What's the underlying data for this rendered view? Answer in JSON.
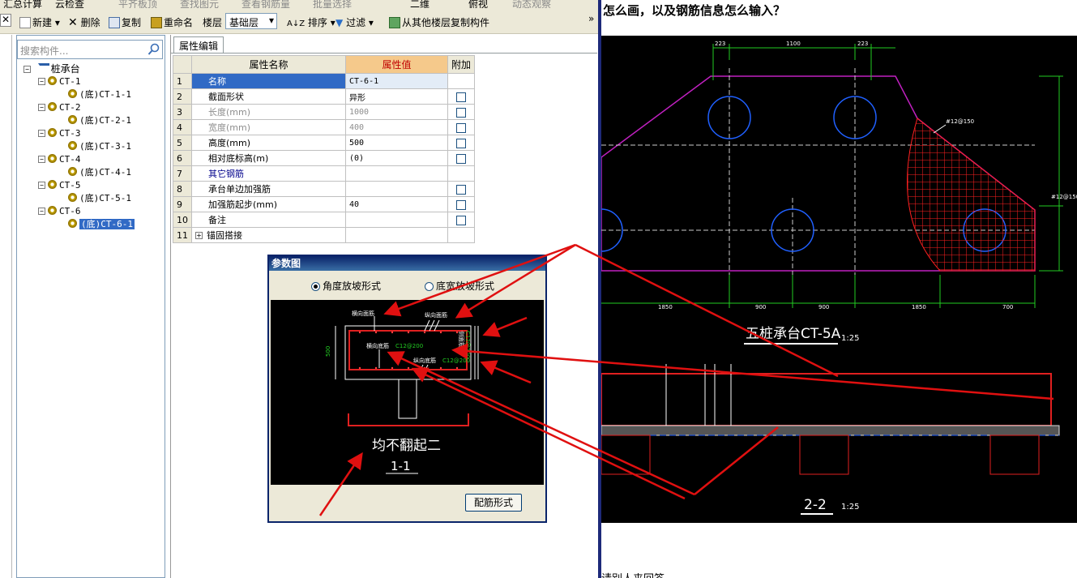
{
  "toolbar_top": {
    "items": [
      "汇总计算",
      "云检查",
      "平齐板顶",
      "查找图元",
      "查看钢筋量",
      "批量选择",
      "二维",
      "俯视",
      "动态观察"
    ]
  },
  "toolbar": {
    "new_label": "新建",
    "delete_label": "删除",
    "copy_label": "复制",
    "rename_label": "重命名",
    "floor_label": "楼层",
    "floor_value": "基础层",
    "sort_label": "排序",
    "filter_label": "过滤",
    "copy_from_floor_label": "从其他楼层复制构件",
    "more": "»"
  },
  "search": {
    "placeholder": "搜索构件..."
  },
  "tree": {
    "root": "桩承台",
    "items": [
      {
        "parent": "CT-1",
        "child": "(底)CT-1-1"
      },
      {
        "parent": "CT-2",
        "child": "(底)CT-2-1"
      },
      {
        "parent": "CT-3",
        "child": "(底)CT-3-1"
      },
      {
        "parent": "CT-4",
        "child": "(底)CT-4-1"
      },
      {
        "parent": "CT-5",
        "child": "(底)CT-5-1"
      },
      {
        "parent": "CT-6",
        "child": "(底)CT-6-1"
      }
    ]
  },
  "prop": {
    "tab": "属性编辑",
    "headers": [
      "属性名称",
      "属性值",
      "附加"
    ],
    "rows": [
      {
        "n": "1",
        "name": "名称",
        "value": "CT-6-1"
      },
      {
        "n": "2",
        "name": "截面形状",
        "value": "异形"
      },
      {
        "n": "3",
        "name": "长度(mm)",
        "value": "1000"
      },
      {
        "n": "4",
        "name": "宽度(mm)",
        "value": "400"
      },
      {
        "n": "5",
        "name": "高度(mm)",
        "value": "500"
      },
      {
        "n": "6",
        "name": "相对底标高(m)",
        "value": "(0)"
      },
      {
        "n": "7",
        "name": "其它钢筋",
        "value": ""
      },
      {
        "n": "8",
        "name": "承台单边加强筋",
        "value": ""
      },
      {
        "n": "9",
        "name": "加强筋起步(mm)",
        "value": "40"
      },
      {
        "n": "10",
        "name": "备注",
        "value": ""
      },
      {
        "n": "11",
        "name": "锚固搭接",
        "value": ""
      }
    ]
  },
  "dialog": {
    "title": "参数图",
    "radio1": "角度放坡形式",
    "radio2": "底宽放坡形式",
    "button": "配筋形式",
    "diagram": {
      "top_h": "横向面筋",
      "top_v": "纵向面筋",
      "bottom_h": "横向底筋",
      "bottom_h_val": "C12@200",
      "bottom_v": "纵向底筋",
      "bottom_v_val": "C12@200",
      "side": "侧面筋",
      "side_val": "C12@200",
      "height": "500",
      "note": "均不翻起二",
      "section": "1-1"
    }
  },
  "cad": {
    "dims_top": [
      "223",
      "1100",
      "223"
    ],
    "dims_bottom": [
      "1850",
      "900",
      "900",
      "1850",
      "700"
    ],
    "title1": "五桩承台CT-5A",
    "scale1": "1:25",
    "title2": "2-2",
    "scale2": "1:25",
    "label_a": "#12@150",
    "label_b": "#12@150"
  },
  "web": {
    "top_text": "怎么画，以及钢筋信息怎么输入？",
    "bottom_text": "请别人来回答"
  }
}
